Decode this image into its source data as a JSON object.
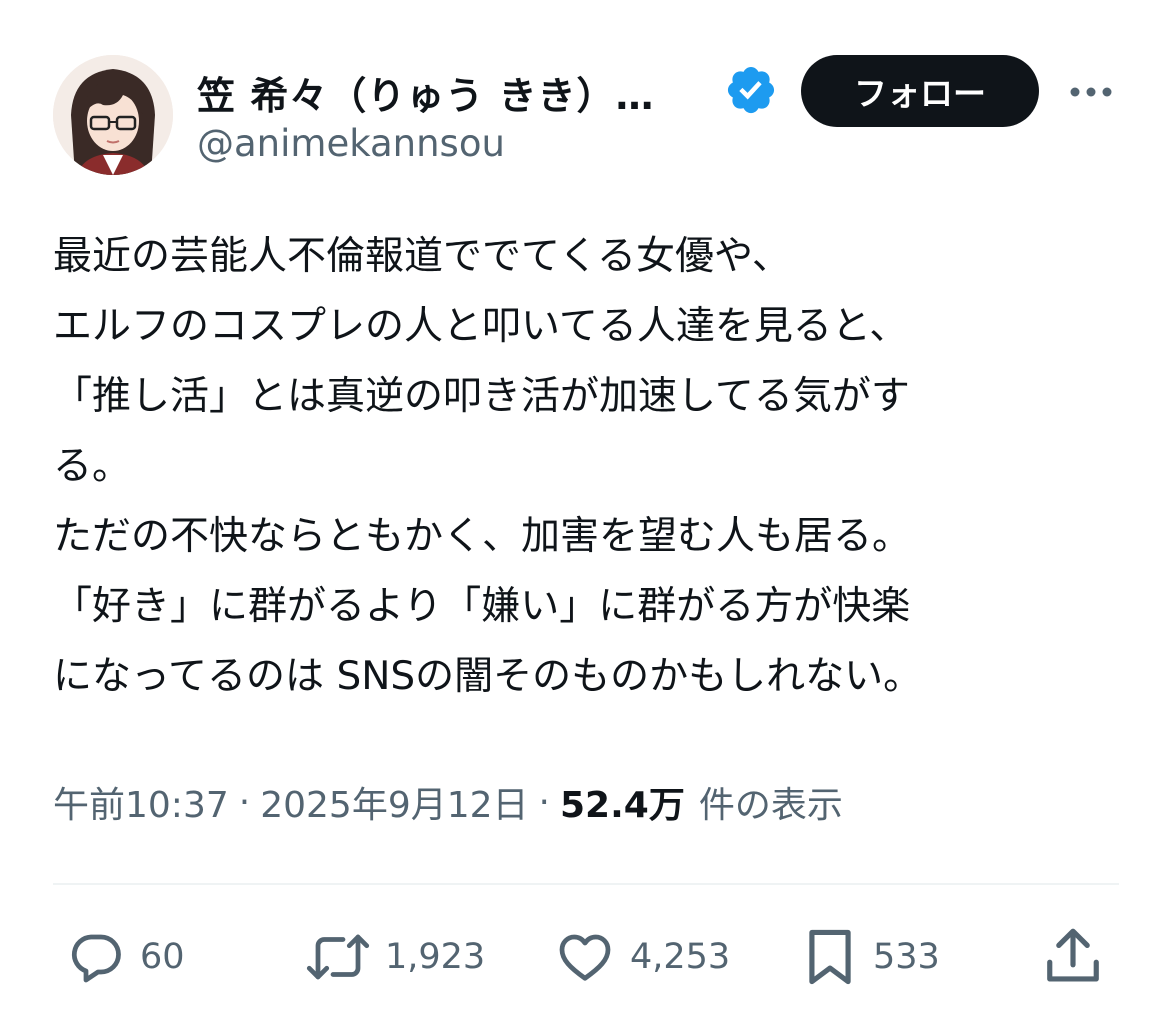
{
  "tweet": {
    "author": {
      "display_name": "笠 希々（りゅう きき）…",
      "handle": "@animekannsou",
      "verified_icon": "verified-badge-icon",
      "avatar_icon": "avatar-anime-girl-glasses"
    },
    "follow_label": "フォロー",
    "more_icon": "more-horizontal-icon",
    "text": "最近の芸能人不倫報道ででてくる女優や、\nエルフのコスプレの人と叩いてる人達を見ると、\n「推し活」とは真逆の叩き活が加速してる気がす\nる。\nただの不快ならともかく、加害を望む人も居る。\n「好き」に群がるより「嫌い」に群がる方が快楽\nになってるのは SNSの闇そのものかもしれない。",
    "time": "午前10:37",
    "separator": "·",
    "date": "2025年9月12日",
    "views_count": "52.4万",
    "views_label": "件の表示"
  },
  "actions": {
    "reply": {
      "icon": "reply-icon",
      "count": "60"
    },
    "retweet": {
      "icon": "retweet-icon",
      "count": "1,923"
    },
    "like": {
      "icon": "heart-icon",
      "count": "4,253"
    },
    "bookmark": {
      "icon": "bookmark-icon",
      "count": "533"
    },
    "share": {
      "icon": "share-icon"
    }
  },
  "colors": {
    "text_primary": "#0f1419",
    "text_secondary": "#536471",
    "verified_blue": "#1d9bf0",
    "divider": "#eff3f4"
  }
}
